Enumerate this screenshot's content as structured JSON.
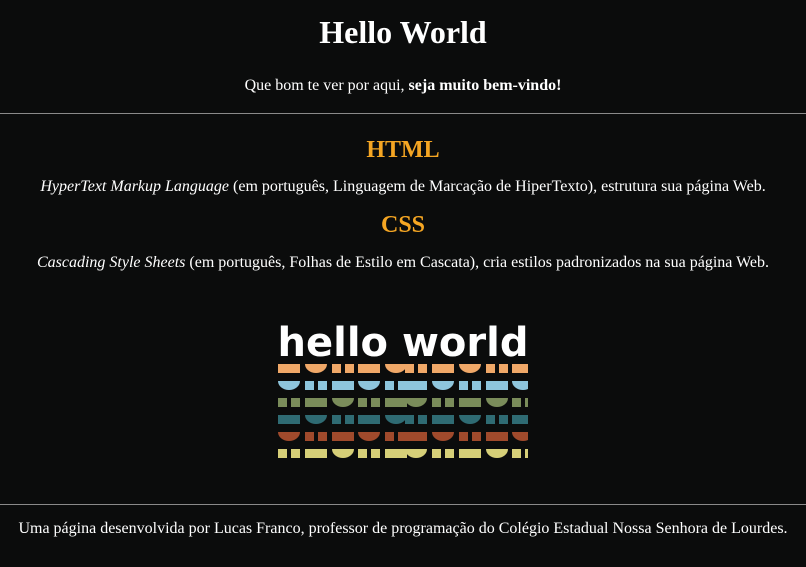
{
  "header": {
    "title": "Hello World",
    "welcome_plain": "Que bom te ver por aqui, ",
    "welcome_bold": "seja muito bem-vindo!"
  },
  "sections": [
    {
      "title": "HTML",
      "term": "HyperText Markup Language",
      "description": " (em português, Linguagem de Marcação de HiperTexto), estrutura sua página Web."
    },
    {
      "title": "CSS",
      "term": "Cascading Style Sheets",
      "description": " (em português, Folhas de Estilo em Cascata), cria estilos padronizados na sua página Web."
    }
  ],
  "logo": {
    "text": "hello world",
    "stripe_colors": [
      "#f0a868",
      "#8ec5dc",
      "#7a8c5a",
      "#2f6b73",
      "#a04a2c",
      "#d6cf78"
    ]
  },
  "footer": {
    "text": "Uma página desenvolvida por Lucas Franco, professor de programação do Colégio Estadual Nossa Senhora de Lourdes."
  },
  "colors": {
    "background": "#0b0c0c",
    "accent": "#f5a623",
    "text": "#ffffff"
  }
}
